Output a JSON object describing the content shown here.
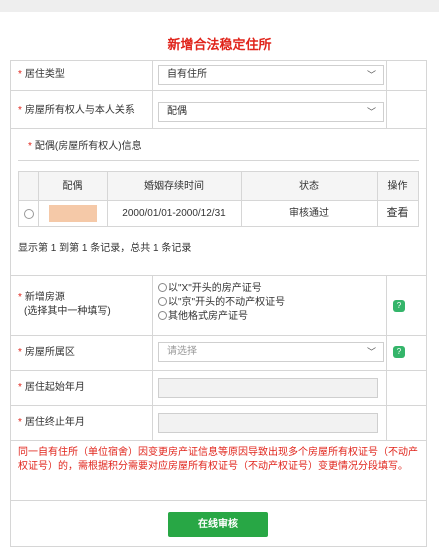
{
  "form_title": "新增合法稳定住所",
  "residence_type": {
    "label": "居住类型",
    "value": "自有住所"
  },
  "relation": {
    "label": "房屋所有权人与本人关系",
    "value": "配偶"
  },
  "spouse_section_title": "配偶(房屋所有权人)信息",
  "spouse_table": {
    "headers": [
      "配偶",
      "婚姻存续时间",
      "状态",
      "操作"
    ],
    "rows": [
      {
        "marriage_period": "2000/01/01-2000/12/31",
        "status": "审核通过",
        "action": "查看"
      }
    ],
    "pagination": "显示第 1 到第 1 条记录，总共 1 条记录"
  },
  "property_source": {
    "label_line1": "新增房源",
    "label_line2": "(选择其中一种填写)",
    "options": [
      "以\"X\"开头的房产证号",
      "以\"京\"开头的不动产权证号",
      "其他格式房产证号"
    ]
  },
  "district": {
    "label": "房屋所属区",
    "placeholder": "请选择"
  },
  "start_month": {
    "label": "居住起始年月"
  },
  "end_month": {
    "label": "居住终止年月"
  },
  "help_icon_text": "?",
  "required_mark": "*",
  "notice": "同一自有住所（单位宿舍）因变更房产证信息等原因导致出现多个房屋所有权证号（不动产权证号）的，需根据积分需要对应房屋所有权证号（不动产权证号）变更情况分段填写。",
  "submit_label": "在线审核",
  "colors": {
    "accent_red": "#e0241b",
    "green": "#28a745",
    "redacted_block": "#f5c9a8"
  }
}
